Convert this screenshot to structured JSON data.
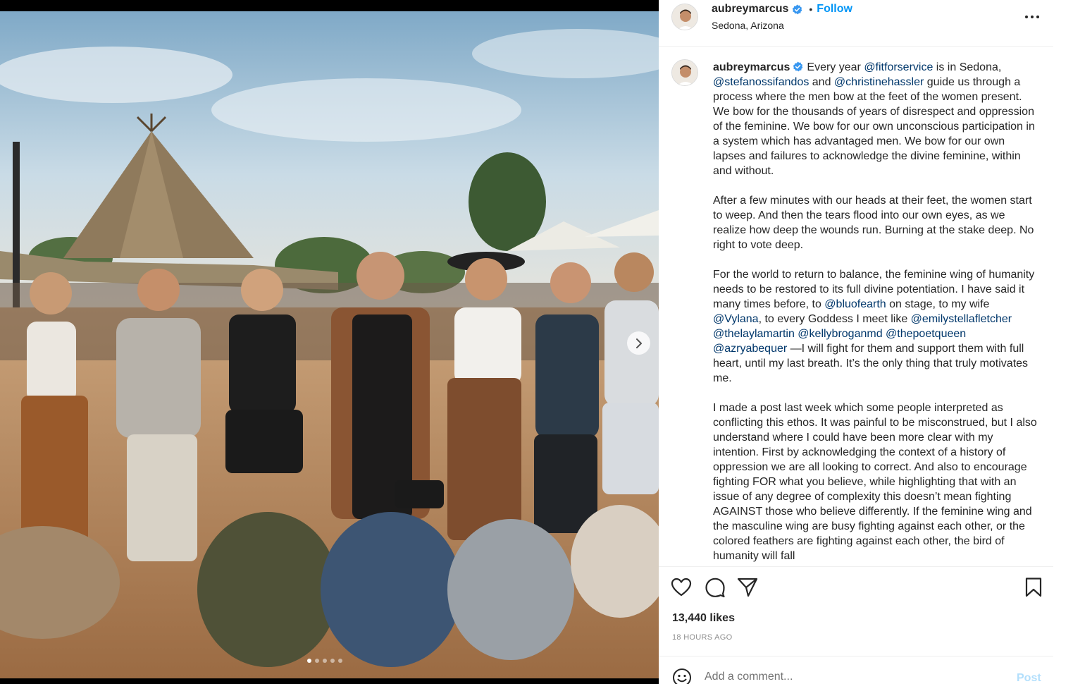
{
  "post": {
    "username": "aubreymarcus",
    "follow_label": "Follow",
    "separator": "•",
    "location": "Sedona, Arizona"
  },
  "carousel": {
    "slide_count": 5,
    "active_slide": 1
  },
  "caption": {
    "username": "aubreymarcus",
    "p1": [
      {
        "t": "text",
        "v": "Every year "
      },
      {
        "t": "mention",
        "v": "@fitforservice"
      },
      {
        "t": "text",
        "v": " is in Sedona, "
      },
      {
        "t": "mention",
        "v": "@stefanossifandos"
      },
      {
        "t": "text",
        "v": " and "
      },
      {
        "t": "mention",
        "v": "@christinehassler"
      },
      {
        "t": "text",
        "v": " guide us through a process where the men bow at the feet of the women present. We bow for the thousands of years of disrespect and oppression of the feminine. We bow for our own unconscious participation in a system which has advantaged men. We bow for our own lapses and failures to acknowledge the divine feminine, within and without."
      }
    ],
    "p2": "After a few minutes with our heads at their feet, the women start to weep. And then the tears flood into our own eyes, as we realize how deep the wounds run. Burning at the stake deep. No right to vote deep.",
    "p3": [
      {
        "t": "text",
        "v": "For the world to return to balance, the feminine wing of humanity needs to be restored to its full divine potentiation. I have said it many times before, to "
      },
      {
        "t": "mention",
        "v": "@bluofearth"
      },
      {
        "t": "text",
        "v": " on stage, to my wife "
      },
      {
        "t": "mention",
        "v": "@Vylana"
      },
      {
        "t": "text",
        "v": ", to every Goddess I meet like "
      },
      {
        "t": "mention",
        "v": "@emilystellafletcher"
      },
      {
        "t": "text",
        "v": " "
      },
      {
        "t": "mention",
        "v": "@thelaylamartin"
      },
      {
        "t": "text",
        "v": " "
      },
      {
        "t": "mention",
        "v": "@kellybroganmd"
      },
      {
        "t": "text",
        "v": " "
      },
      {
        "t": "mention",
        "v": "@thepoetqueen"
      },
      {
        "t": "text",
        "v": " "
      },
      {
        "t": "mention",
        "v": "@azryabequer"
      },
      {
        "t": "text",
        "v": " —I will fight for them and support them with full heart, until my last breath. It’s the only thing that truly motivates me."
      }
    ],
    "p4": "I made a post last week which some people interpreted as conflicting this ethos. It was painful to be misconstrued, but I also understand where I could have been more clear with my intention. First by acknowledging the context of a history of oppression we are all looking to correct. And also to encourage fighting FOR what you believe, while highlighting that with an issue of any degree of complexity this doesn’t mean fighting AGAINST those who believe differently. If the feminine wing and the masculine wing are busy fighting against each other, or the colored feathers are fighting against each other, the bird of humanity will fall"
  },
  "engagement": {
    "likes": "13,440 likes",
    "timestamp": "18 HOURS AGO"
  },
  "comment": {
    "placeholder": "Add a comment...",
    "post_label": "Post"
  },
  "icons": {
    "like": "heart-icon",
    "comment": "comment-bubble-icon",
    "share": "paper-plane-icon",
    "save": "bookmark-icon",
    "more": "ellipsis-icon",
    "verified": "verified-badge-icon",
    "next": "chevron-right-icon",
    "emoji": "smiley-icon"
  },
  "colors": {
    "link_blue": "#0095f6",
    "mention_blue": "#00376b",
    "verified_blue": "#3897f0",
    "post_disabled": "#b2dffc",
    "muted": "#8e8e8e"
  }
}
